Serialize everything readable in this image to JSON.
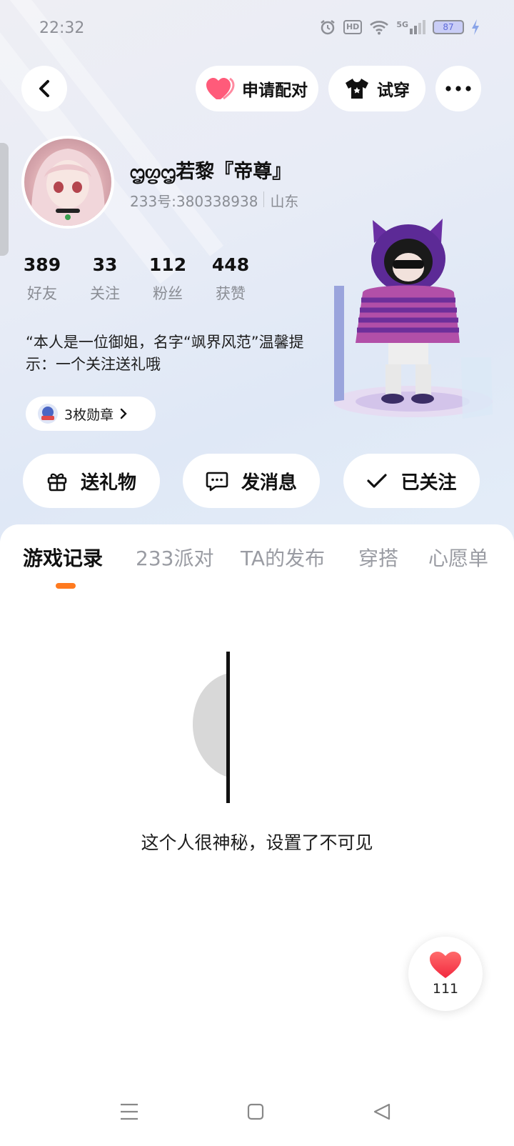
{
  "status_bar": {
    "time": "22:32",
    "hd": "HD",
    "network": "5G",
    "battery": "87"
  },
  "header": {
    "pair_label": "申请配对",
    "tryon_label": "试穿"
  },
  "profile": {
    "nickname": "ᦗᦛᦗ若黎『帝尊』",
    "uid": "233号:380338938",
    "location": "山东",
    "stats": [
      {
        "value": "389",
        "label": "好友"
      },
      {
        "value": "33",
        "label": "关注"
      },
      {
        "value": "112",
        "label": "粉丝"
      },
      {
        "value": "448",
        "label": "获赞"
      }
    ],
    "bio": "“本人是一位御姐，名字“飒界风范”温馨提示：一个关注送礼哦",
    "badge": "3枚勋章"
  },
  "actions": {
    "gift": "送礼物",
    "message": "发消息",
    "followed": "已关注"
  },
  "tabs": [
    "游戏记录",
    "233派对",
    "TA的发布",
    "穿搭",
    "心愿单"
  ],
  "empty_state": "这个人很神秘，设置了不可见",
  "like_count": "111",
  "colors": {
    "accent": "#ff7a1f",
    "heart": "#ff4d5e"
  }
}
